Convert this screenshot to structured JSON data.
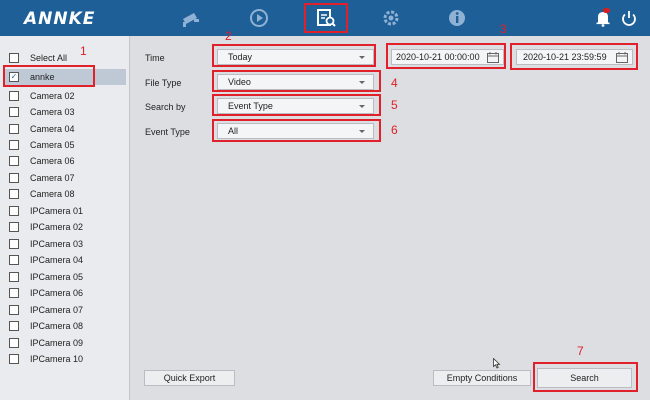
{
  "app": {
    "logo": "ANNKE"
  },
  "nav": {
    "icons": [
      "camera-icon",
      "playback-icon",
      "search-playback-icon",
      "settings-gear-icon",
      "info-icon",
      "alarm-bell-icon",
      "power-icon"
    ],
    "active": "search-playback-icon"
  },
  "sidebar": {
    "select_all_label": "Select All",
    "cameras": [
      {
        "label": "annke",
        "checked": true
      },
      {
        "label": "Camera 02",
        "checked": false
      },
      {
        "label": "Camera 03",
        "checked": false
      },
      {
        "label": "Camera 04",
        "checked": false
      },
      {
        "label": "Camera 05",
        "checked": false
      },
      {
        "label": "Camera 06",
        "checked": false
      },
      {
        "label": "Camera 07",
        "checked": false
      },
      {
        "label": "Camera 08",
        "checked": false
      },
      {
        "label": "IPCamera 01",
        "checked": false
      },
      {
        "label": "IPCamera 02",
        "checked": false
      },
      {
        "label": "IPCamera 03",
        "checked": false
      },
      {
        "label": "IPCamera 04",
        "checked": false
      },
      {
        "label": "IPCamera 05",
        "checked": false
      },
      {
        "label": "IPCamera 06",
        "checked": false
      },
      {
        "label": "IPCamera 07",
        "checked": false
      },
      {
        "label": "IPCamera 08",
        "checked": false
      },
      {
        "label": "IPCamera 09",
        "checked": false
      },
      {
        "label": "IPCamera 10",
        "checked": false
      }
    ]
  },
  "form": {
    "time_label": "Time",
    "time_value": "Today",
    "start_time": "2020-10-21 00:00:00",
    "end_time": "2020-10-21 23:59:59",
    "file_type_label": "File Type",
    "file_type_value": "Video",
    "search_by_label": "Search by",
    "search_by_value": "Event Type",
    "event_type_label": "Event Type",
    "event_type_value": "All"
  },
  "buttons": {
    "quick_export": "Quick Export",
    "empty_conditions": "Empty Conditions",
    "search": "Search"
  },
  "annotations": [
    "1",
    "2",
    "3",
    "4",
    "5",
    "6",
    "7"
  ],
  "colors": {
    "topbar": "#1f5f98",
    "highlight": "#e0202a",
    "selected_row": "#bfc9d6"
  }
}
